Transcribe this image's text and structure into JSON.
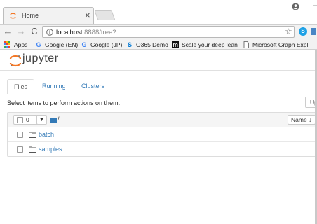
{
  "browser": {
    "tab_title": "Home",
    "tab_close": "×",
    "url_host": "localhost",
    "url_path": ":8888/tree?",
    "nav_back": "←",
    "nav_forward": "→",
    "nav_reload": "C",
    "star": "☆",
    "window_minimize": "—"
  },
  "bookmarks": [
    {
      "label": "Apps",
      "icon": "apps-grid-icon"
    },
    {
      "label": "Google (EN)",
      "icon": "google-icon"
    },
    {
      "label": "Google (JP)",
      "icon": "google-icon"
    },
    {
      "label": "O365 Demo",
      "icon": "sharepoint-icon"
    },
    {
      "label": "Scale your deep lean",
      "icon": "m-icon"
    },
    {
      "label": "Microsoft Graph Expl",
      "icon": "page-icon"
    }
  ],
  "jupyter": {
    "title": "jupyter",
    "tabs": [
      "Files",
      "Running",
      "Clusters"
    ],
    "hint": "Select items to perform actions on them.",
    "upload_label": "Upl",
    "selected_count": "0",
    "dropdown_caret": "▼",
    "breadcrumb_sep": "/",
    "sort_label": "Name ↓",
    "files": [
      {
        "name": "batch",
        "type": "folder"
      },
      {
        "name": "samples",
        "type": "folder"
      }
    ]
  },
  "colors": {
    "link": "#337ab7",
    "jupyter_orange": "#f37726",
    "chrome_bg": "#f2f2f2"
  }
}
